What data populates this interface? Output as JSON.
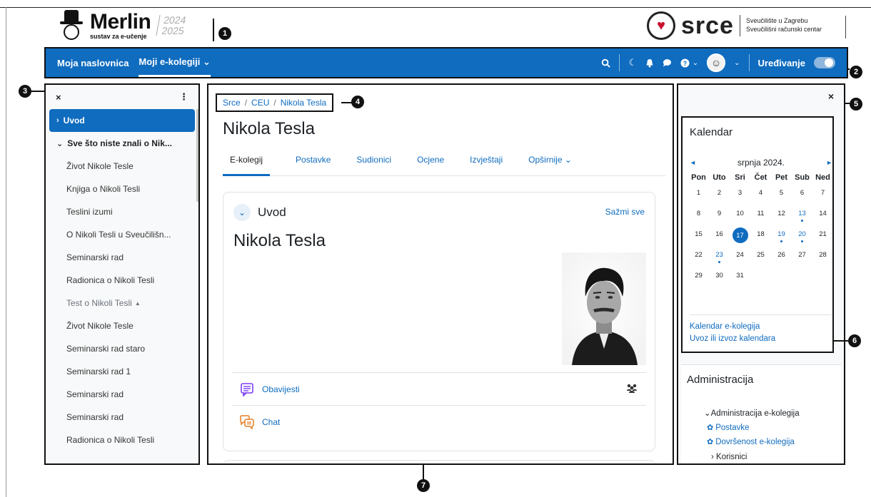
{
  "header": {
    "logo_name": "Merlin",
    "logo_sub": "sustav za e-učenje",
    "year_start": "2024",
    "year_end": "2025",
    "partner_word": "srce",
    "partner_line1": "Sveučilište u Zagrebu",
    "partner_line2": "Sveučilišni računski centar"
  },
  "navbar": {
    "items": [
      {
        "label": "Moja naslovnica"
      },
      {
        "label": "Moji e-kolegiji",
        "suffix": "⌄"
      }
    ],
    "edit_label": "Uređivanje",
    "edit_mode": false
  },
  "markers": [
    "1",
    "2",
    "3",
    "4",
    "5",
    "6",
    "7"
  ],
  "left_drawer": {
    "close_glyph": "×",
    "menu_glyph": "⋮",
    "items": [
      {
        "label": "Uvod"
      },
      {
        "label": "Sve što niste znali o Nik..."
      },
      {
        "label": "Život Nikole Tesle"
      },
      {
        "label": "Knjiga o Nikoli Tesli"
      },
      {
        "label": "Teslini izumi"
      },
      {
        "label": "O Nikoli Tesli u Sveučilišn..."
      },
      {
        "label": "Seminarski rad"
      },
      {
        "label": "Radionica o Nikoli Tesli"
      },
      {
        "label": "Test o Nikoli Tesli"
      },
      {
        "label": "Život Nikole Tesle"
      },
      {
        "label": "Seminarski rad staro"
      },
      {
        "label": "Seminarski rad 1"
      },
      {
        "label": "Seminarski rad"
      },
      {
        "label": "Seminarski rad"
      },
      {
        "label": "Radionica o Nikoli Tesli"
      }
    ]
  },
  "main": {
    "breadcrumb": [
      "Srce",
      "CEU",
      "Nikola Tesla"
    ],
    "breadcrumb_sep": "/",
    "title": "Nikola Tesla",
    "tabs": [
      "E-kolegij",
      "Postavke",
      "Sudionici",
      "Ocjene",
      "Izvještaji",
      "Opširnije ⌄"
    ],
    "section": {
      "toggle_glyph": "⌄",
      "title": "Uvod",
      "collapse_all": "Sažmi sve",
      "heading": "Nikola Tesla"
    },
    "activities": [
      {
        "label": "Obavijesti",
        "icon": "forum-icon",
        "color": "#7b3ff2"
      },
      {
        "label": "Chat",
        "icon": "chat-icon",
        "color": "#e67e22"
      }
    ]
  },
  "right_drawer": {
    "close_glyph": "×",
    "calendar": {
      "title": "Kalendar",
      "month": "srpnja 2024.",
      "prev_glyph": "◄",
      "next_glyph": "►",
      "dow": [
        "Pon",
        "Uto",
        "Sri",
        "Čet",
        "Pet",
        "Sub",
        "Ned"
      ],
      "first_offset": 0,
      "days_in_month": 31,
      "today": 17,
      "event_days": [
        13,
        19,
        20,
        23
      ],
      "links": [
        "Kalendar e-kolegija",
        "Uvoz ili izvoz kalendara"
      ]
    },
    "admin": {
      "title": "Administracija",
      "node": "Administracija e-kolegija",
      "links": [
        "Postavke",
        "Dovršenost e-kolegija"
      ],
      "sub": "Korisnici"
    }
  },
  "colors": {
    "brand": "#0f6cbf",
    "forum": "#7b3ff2",
    "chat": "#e67e22"
  }
}
